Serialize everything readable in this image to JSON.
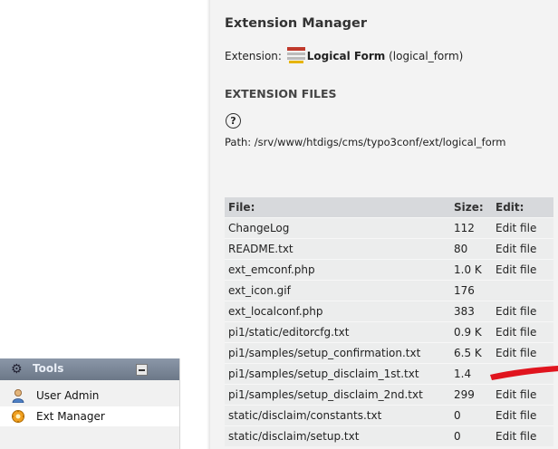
{
  "extension_manager": {
    "title": "Extension Manager",
    "extension_label": "Extension:",
    "extension_name": "Logical Form",
    "extension_key": "(logical_form)",
    "section_heading": "EXTENSION FILES",
    "help_icon": "help-icon",
    "path_text": "Path: /srv/www/htdigs/cms/typo3conf/ext/logical_form",
    "table": {
      "headers": {
        "file": "File:",
        "size": "Size:",
        "edit": "Edit:"
      },
      "rows": [
        {
          "file": "ChangeLog",
          "size": "112",
          "edit": "Edit file"
        },
        {
          "file": "README.txt",
          "size": "80",
          "edit": "Edit file"
        },
        {
          "file": "ext_emconf.php",
          "size": "1.0 K",
          "edit": "Edit file"
        },
        {
          "file": "ext_icon.gif",
          "size": "176",
          "edit": ""
        },
        {
          "file": "ext_localconf.php",
          "size": "383",
          "edit": "Edit file"
        },
        {
          "file": "pi1/static/editorcfg.txt",
          "size": "0.9 K",
          "edit": "Edit file"
        },
        {
          "file": "pi1/samples/setup_confirmation.txt",
          "size": "6.5 K",
          "edit": "Edit file"
        },
        {
          "file": "pi1/samples/setup_disclaim_1st.txt",
          "size": "1.4",
          "edit": ""
        },
        {
          "file": "pi1/samples/setup_disclaim_2nd.txt",
          "size": "299",
          "edit": "Edit file"
        },
        {
          "file": "static/disclaim/constants.txt",
          "size": "0",
          "edit": "Edit file"
        },
        {
          "file": "static/disclaim/setup.txt",
          "size": "0",
          "edit": "Edit file"
        }
      ]
    },
    "annotation_color": "#e0141e"
  },
  "tools_panel": {
    "header_label": "Tools",
    "header_icon": "tools-icon",
    "items": [
      {
        "label": "User Admin",
        "icon": "user-admin-icon"
      },
      {
        "label": "Ext Manager",
        "icon": "ext-manager-icon"
      }
    ]
  }
}
